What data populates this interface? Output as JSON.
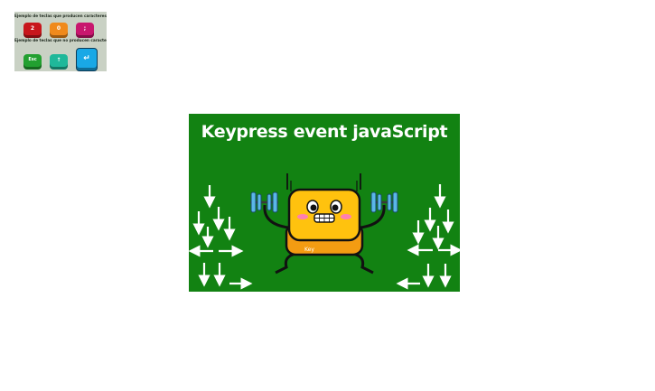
{
  "thumbnail": {
    "caption_top": "Ejemplo de teclas que producen caracteres",
    "caption_bottom": "Ejemplo de teclas que no producen caracteres",
    "keys_top": [
      "2",
      "0",
      ";"
    ],
    "key_esc": "Esc",
    "key_up": "↑",
    "key_enter": "↵"
  },
  "banner": {
    "title": "Keypress event javaScript",
    "key_label": "Key",
    "colors": {
      "background": "#128212",
      "key_body": "#ffc20e",
      "key_base": "#f39c12",
      "arrows": "#ffffff"
    }
  }
}
